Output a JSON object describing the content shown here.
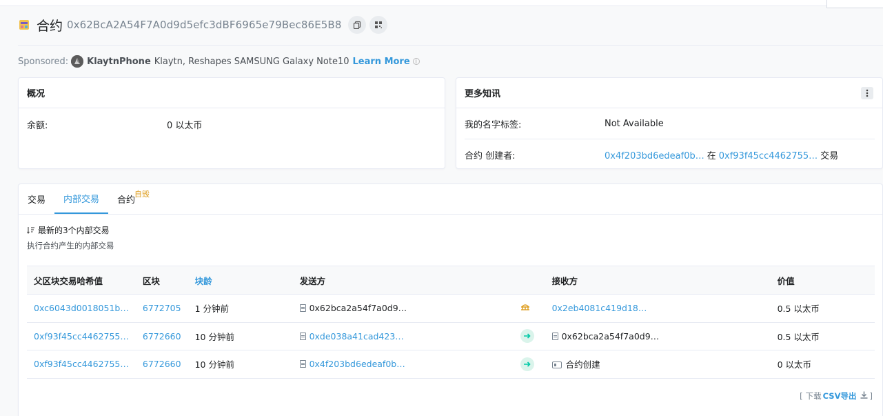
{
  "header": {
    "title_label": "合约",
    "address": "0x62BcA2A54F7A0d9d5efc3dBF6965e79Bec86E5B8",
    "copy_icon": "copy-icon",
    "qr_icon": "qr-icon"
  },
  "sponsored": {
    "prefix": "Sponsored:",
    "brand": "KlaytnPhone",
    "text": "Klaytn, Reshapes SAMSUNG Galaxy Note10",
    "link": "Learn More",
    "info_glyph": "i"
  },
  "overview": {
    "title": "概况",
    "balance_label": "余额:",
    "balance_value": "0 以太币"
  },
  "more_info": {
    "title": "更多知讯",
    "name_tag_label": "我的名字标签:",
    "name_tag_value": "Not Available",
    "creator_label": "合约 创建者:",
    "creator_address": "0x4f203bd6edeaf0b…",
    "at_text": "在",
    "creator_tx": "0xf93f45cc4462755…",
    "tx_suffix": "交易"
  },
  "tabs": {
    "tab1": "交易",
    "tab2": "内部交易",
    "tab3": "合约",
    "tab3_badge": "自毁"
  },
  "internal": {
    "latest": "最新的3个内部交易",
    "subtitle": "执行合约产生的内部交易",
    "columns": {
      "parent_hash": "父区块交易哈希值",
      "block": "区块",
      "age": "块龄",
      "from": "发送方",
      "to": "接收方",
      "value": "价值"
    },
    "rows": [
      {
        "hash": "0xc6043d0018051b…",
        "block": "6772705",
        "age": "1 分钟前",
        "from": "0x62bca2a54f7a0d9…",
        "to": "0x2eb4081c419d18…",
        "value": "0.5 以太币"
      },
      {
        "hash": "0xf93f45cc4462755…",
        "block": "6772660",
        "age": "10 分钟前",
        "from": "0xde038a41cad423…",
        "to": "0x62bca2a54f7a0d9…",
        "value": "0.5 以太币"
      },
      {
        "hash": "0xf93f45cc4462755…",
        "block": "6772660",
        "age": "10 分钟前",
        "from": "0x4f203bd6edeaf0b…",
        "to": "合约创建",
        "value": "0 以太币"
      }
    ]
  },
  "footer": {
    "open_bracket": "[",
    "download": "下载",
    "csv_export": "CSV导出",
    "close_bracket": "]"
  },
  "colors": {
    "link": "#3498db",
    "success": "#00c9a7",
    "warning": "#de9e20"
  }
}
